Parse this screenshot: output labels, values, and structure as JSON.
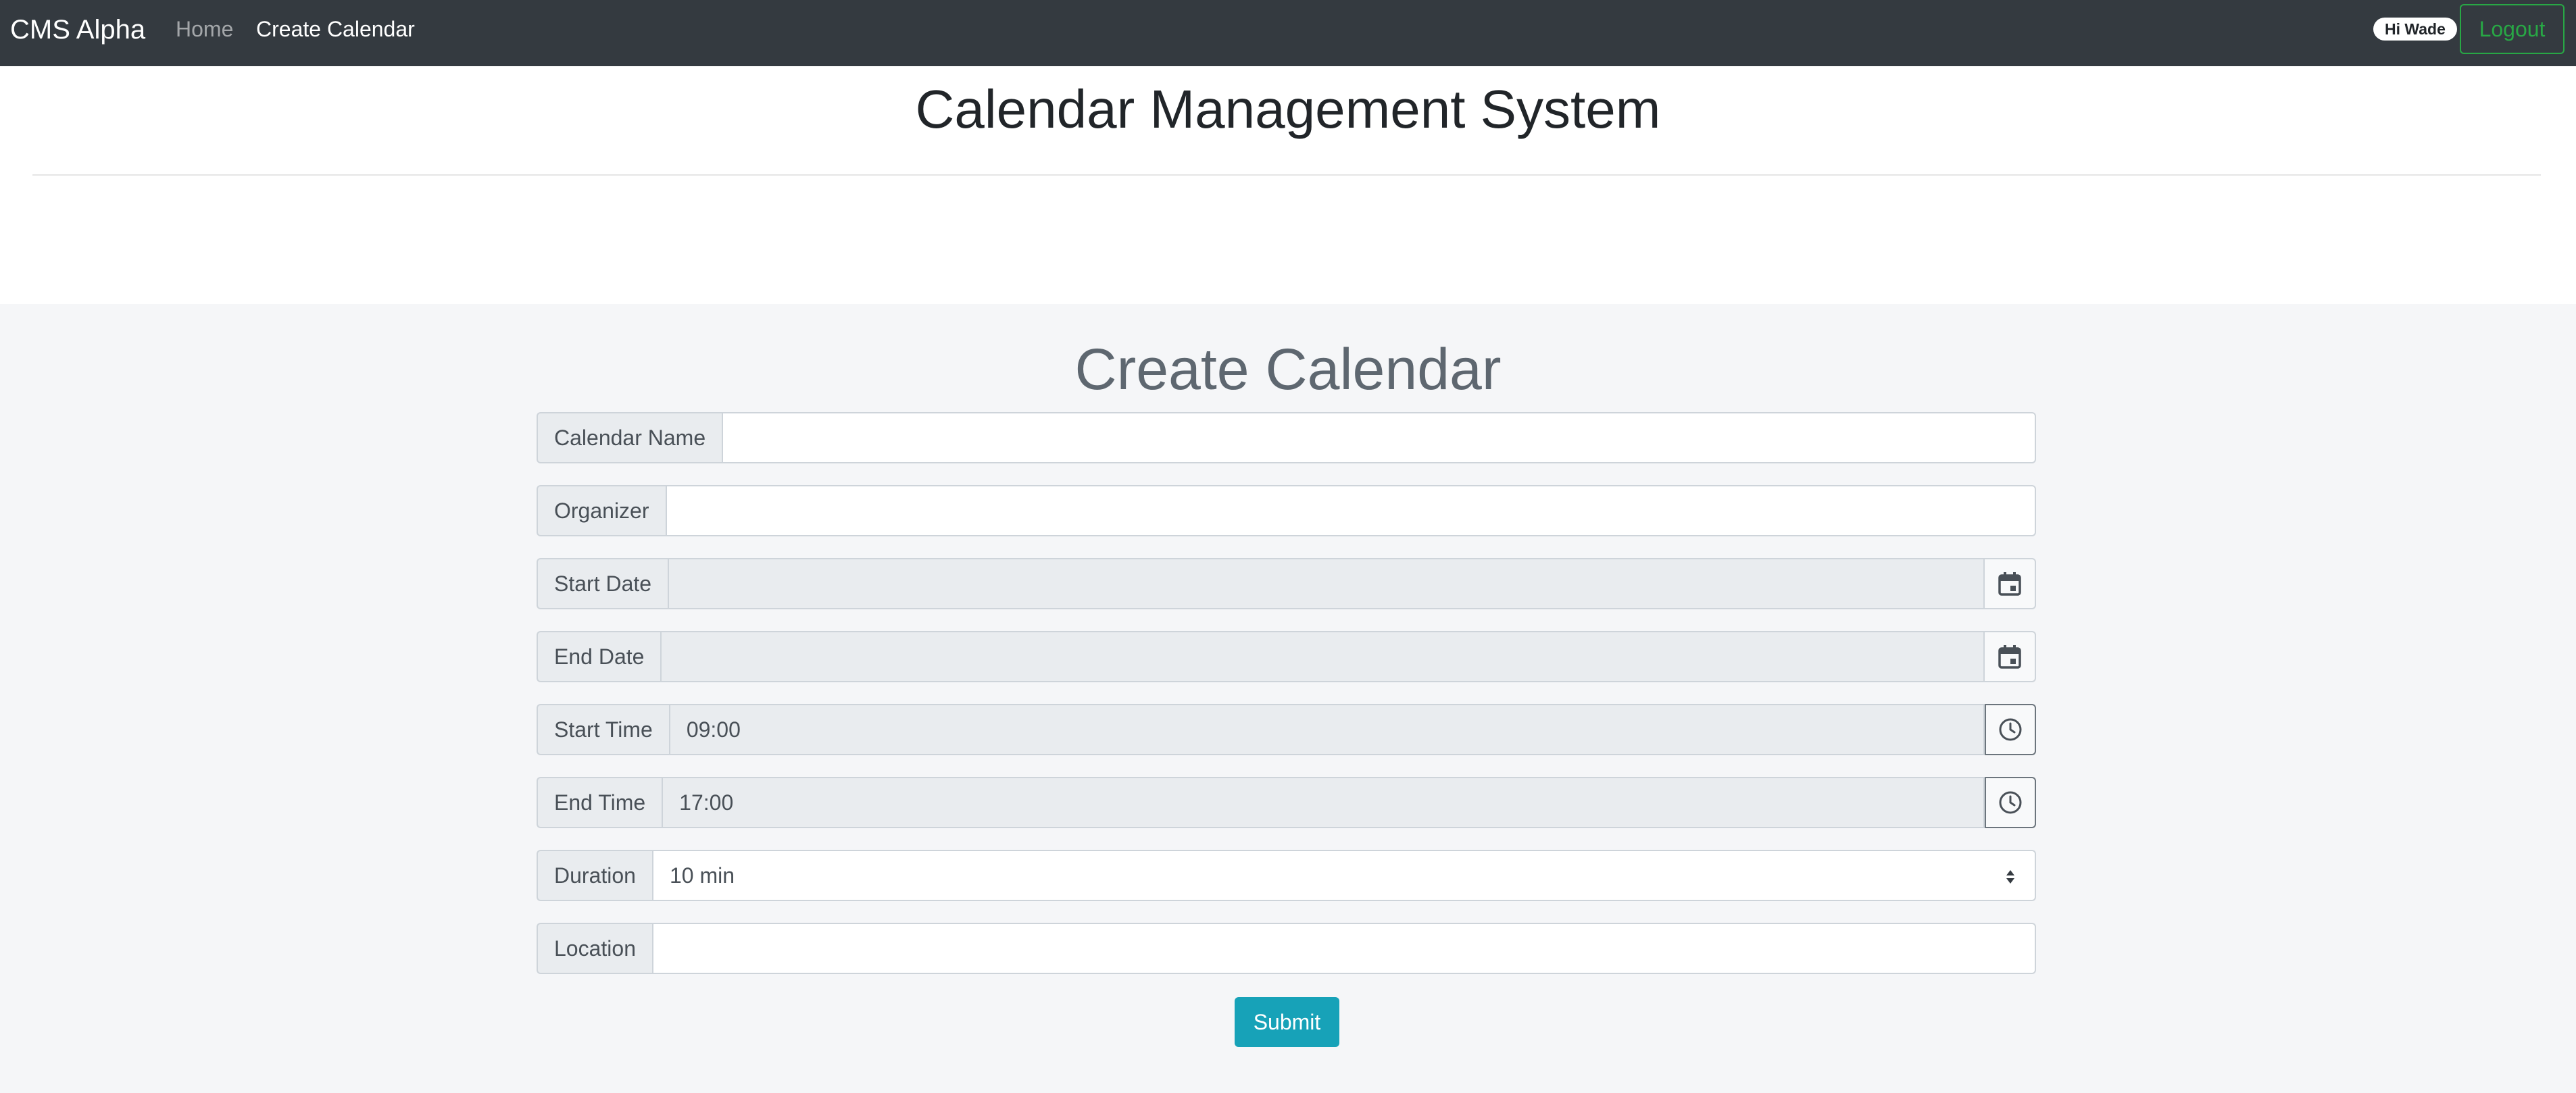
{
  "navbar": {
    "brand": "CMS Alpha",
    "links": [
      {
        "label": "Home"
      },
      {
        "label": "Create Calendar"
      }
    ],
    "greeting": "Hi Wade",
    "logout_label": "Logout"
  },
  "header": {
    "title": "Calendar Management System"
  },
  "form": {
    "title": "Create Calendar",
    "fields": {
      "calendar_name": {
        "label": "Calendar Name",
        "value": ""
      },
      "organizer": {
        "label": "Organizer",
        "value": ""
      },
      "start_date": {
        "label": "Start Date",
        "value": "",
        "icon": "calendar-icon"
      },
      "end_date": {
        "label": "End Date",
        "value": "",
        "icon": "calendar-icon"
      },
      "start_time": {
        "label": "Start Time",
        "value": "09:00",
        "icon": "clock-icon"
      },
      "end_time": {
        "label": "End Time",
        "value": "17:00",
        "icon": "clock-icon"
      },
      "duration": {
        "label": "Duration",
        "selected": "10 min",
        "icon": "select-caret-icon"
      },
      "location": {
        "label": "Location",
        "value": ""
      }
    },
    "submit_label": "Submit"
  },
  "colors": {
    "navbar_bg": "#343a40",
    "logout_accent": "#28a745",
    "submit_bg": "#17a2b8",
    "section_bg": "#f5f6f8"
  }
}
